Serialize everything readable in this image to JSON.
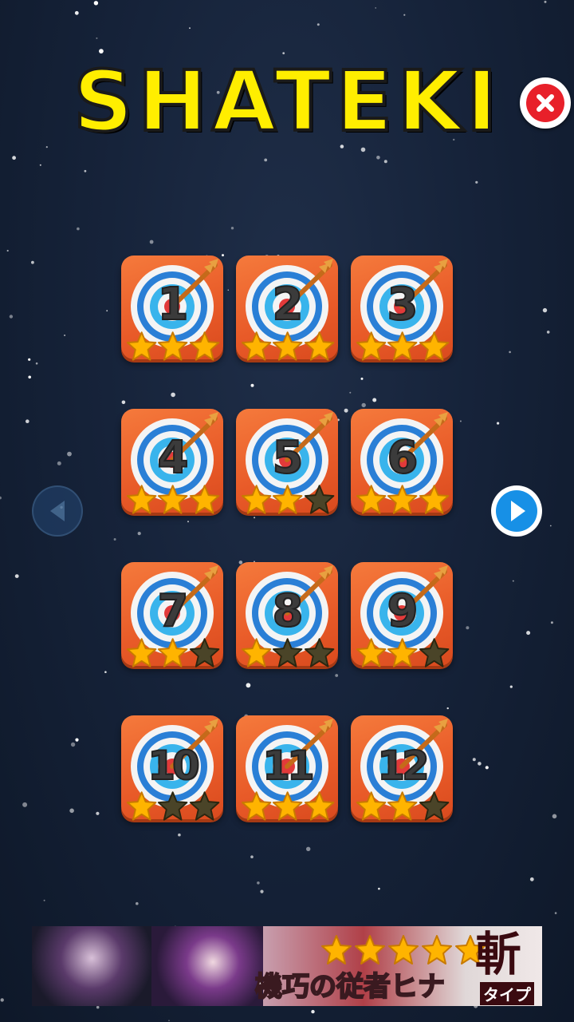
{
  "app": {
    "title": "SHATEKI"
  },
  "controls": {
    "close_icon": "close-icon",
    "prev_icon": "prev-arrow-icon",
    "next_icon": "next-arrow-icon",
    "prev_enabled": false,
    "next_enabled": true
  },
  "levels": [
    {
      "number": "1",
      "stars": 3
    },
    {
      "number": "2",
      "stars": 3
    },
    {
      "number": "3",
      "stars": 3
    },
    {
      "number": "4",
      "stars": 3
    },
    {
      "number": "5",
      "stars": 2
    },
    {
      "number": "6",
      "stars": 3
    },
    {
      "number": "7",
      "stars": 2
    },
    {
      "number": "8",
      "stars": 1
    },
    {
      "number": "9",
      "stars": 2
    },
    {
      "number": "10",
      "stars": 1
    },
    {
      "number": "11",
      "stars": 3
    },
    {
      "number": "12",
      "stars": 2
    }
  ],
  "ad_banner": {
    "text": "機巧の従者ヒナ",
    "kanji": "斬",
    "type_label": "タイプ",
    "rating_stars": 5
  },
  "colors": {
    "title": "#ffee00",
    "tile": "#e85a28",
    "star_on": "#ffb400",
    "star_off": "#4a4428",
    "next_button": "#1790e6",
    "close_button": "#e8202a"
  }
}
